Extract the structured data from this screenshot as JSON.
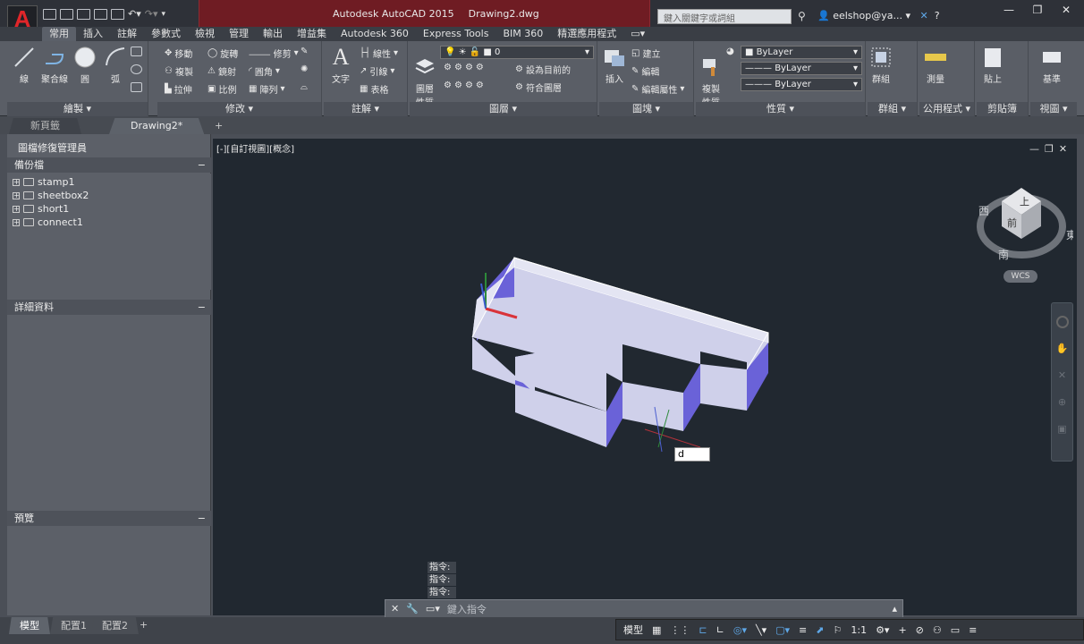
{
  "app": {
    "logo": "A",
    "title": "Autodesk AutoCAD 2015",
    "file": "Drawing2.dwg"
  },
  "search": {
    "placeholder": "鍵入關鍵字或詞組"
  },
  "user": {
    "name": "eelshop@ya..."
  },
  "tabs": [
    "常用",
    "插入",
    "註解",
    "參數式",
    "檢視",
    "管理",
    "輸出",
    "增益集",
    "Autodesk 360",
    "Express Tools",
    "BIM 360",
    "精選應用程式"
  ],
  "ribbon": {
    "draw": {
      "title": "繪製",
      "line": "線",
      "polyline": "聚合線",
      "circle": "圓",
      "arc": "弧"
    },
    "modify": {
      "title": "修改",
      "move": "移動",
      "rotate": "旋轉",
      "trim": "修剪",
      "copy": "複製",
      "mirror": "鏡射",
      "fillet": "圓角",
      "stretch": "拉伸",
      "scale": "比例",
      "array": "陣列"
    },
    "annotation": {
      "title": "註解",
      "text": "文字",
      "linear": "線性",
      "leader": "引線",
      "table": "表格"
    },
    "layers": {
      "title": "圖層",
      "props": "圖層\n性質",
      "layer_value": "0",
      "make_current": "設為目前的",
      "match": "符合圖層"
    },
    "block": {
      "title": "圖塊",
      "insert": "插入",
      "create": "建立",
      "edit": "編輯",
      "edit_attr": "編輯屬性"
    },
    "properties": {
      "title": "性質",
      "match": "複製\n性質",
      "color": "ByLayer",
      "linetype": "ByLayer",
      "lineweight": "ByLayer"
    },
    "groups": {
      "title": "群組",
      "group": "群組"
    },
    "utilities": {
      "title": "公用程式",
      "measure": "測量"
    },
    "clipboard": {
      "title": "剪貼簿",
      "paste": "貼上"
    },
    "view": {
      "title": "視圖",
      "base": "基準"
    }
  },
  "doctabs": {
    "start": "新頁籤",
    "drawing": "Drawing2*",
    "add": "+"
  },
  "palette": {
    "title": "圖檔修復管理員",
    "backup": "備份檔",
    "items": [
      "stamp1",
      "sheetbox2",
      "short1",
      "connect1"
    ],
    "details": "詳細資料",
    "preview": "預覽"
  },
  "viewport": {
    "label": "[-][自訂視圖][概念]",
    "cube": {
      "top": "上",
      "front": "前",
      "north": "",
      "east": "東",
      "south": "南",
      "west": "西"
    },
    "wcs": "WCS",
    "input": "d"
  },
  "command": {
    "history": [
      "指令:",
      "指令:",
      "指令:"
    ],
    "placeholder": "鍵入指令"
  },
  "layouts": [
    "模型",
    "配置1",
    "配置2"
  ],
  "status": {
    "model": "模型",
    "scale": "1:1"
  },
  "colors": {
    "wall_top": "#cfd0ea",
    "wall_side": "#6a62d8",
    "viewport": "#212830",
    "ribbon": "#5a5e66"
  }
}
